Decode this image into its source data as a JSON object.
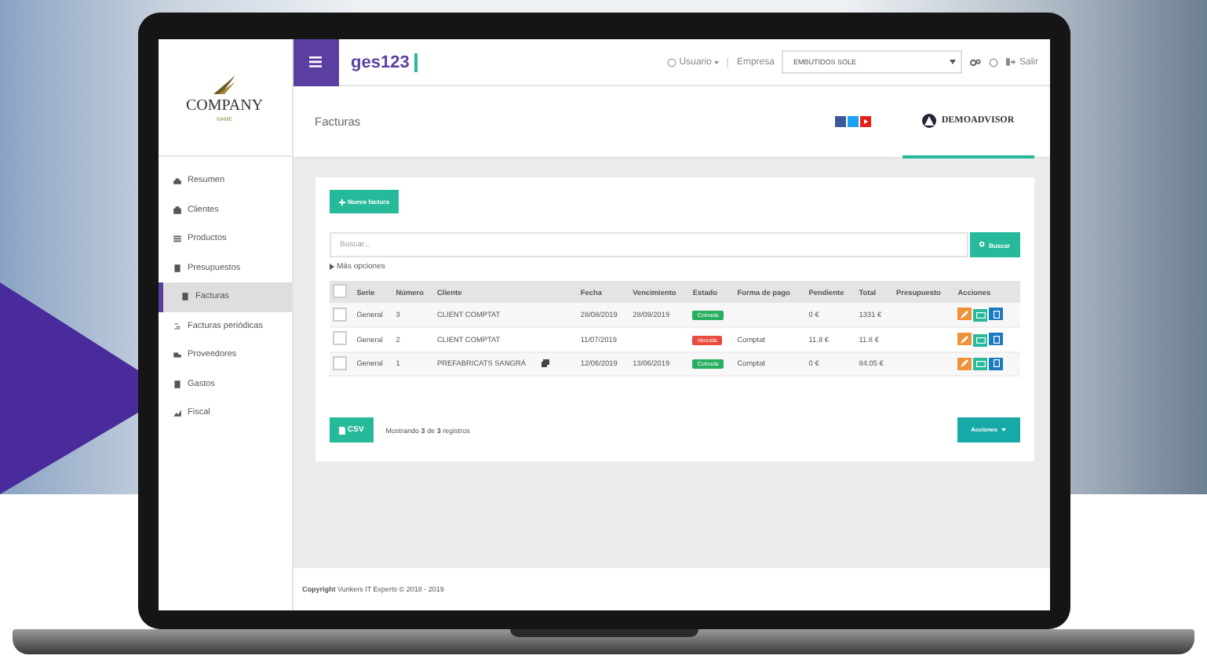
{
  "topbar": {
    "brand": "ges123",
    "user": "Usuario",
    "company_label": "Empresa",
    "company_value": "EMBUTIDOS SOLE",
    "logout": "Salir"
  },
  "logo": {
    "name": "COMPANY",
    "sub": "NAME"
  },
  "header": {
    "title": "Facturas",
    "partner": "DEMOADVISOR"
  },
  "sidebar": {
    "items": [
      {
        "label": "Resumen",
        "selected": false
      },
      {
        "label": "Clientes",
        "selected": false
      },
      {
        "label": "Productos",
        "selected": false
      },
      {
        "label": "Presupuestos",
        "selected": false
      },
      {
        "label": "Facturas",
        "selected": true
      },
      {
        "label": "Facturas periódicas",
        "selected": false
      },
      {
        "label": "Proveedores",
        "selected": false
      },
      {
        "label": "Gastos",
        "selected": false
      },
      {
        "label": "Fiscal",
        "selected": false
      }
    ]
  },
  "new_button": "Nueva factura",
  "search": {
    "placeholder": "Buscar...",
    "button": "Buscar"
  },
  "more_options": "Más opciones",
  "table": {
    "all_checked": false,
    "columns": [
      "Serie",
      "Número",
      "Cliente",
      "Fecha",
      "Vencimiento",
      "Estado",
      "Forma de pago",
      "Pendiente",
      "Total",
      "Presupuesto",
      "Acciones"
    ],
    "rows": [
      {
        "checked": false,
        "serie": "General",
        "numero": "3",
        "cliente": "CLIENT COMPTAT",
        "linked": false,
        "fecha": "28/08/2019",
        "vencimiento": "28/09/2019",
        "estado": "Cobrada",
        "color": "#27ae60",
        "pago": "",
        "pendiente": "0 €",
        "total": "1331 €"
      },
      {
        "checked": false,
        "serie": "General",
        "numero": "2",
        "cliente": "CLIENT COMPTAT",
        "linked": false,
        "fecha": "11/07/2019",
        "vencimiento": "",
        "estado": "Vencida",
        "color": "#e74c3c",
        "pago": "Comptat",
        "pendiente": "11.8 €",
        "total": "11.8 €"
      },
      {
        "checked": false,
        "serie": "General",
        "numero": "1",
        "cliente": "PREFABRICATS SANGRÀ",
        "linked": true,
        "fecha": "12/06/2019",
        "vencimiento": "13/06/2019",
        "estado": "Cobrada",
        "color": "#27ae60",
        "pago": "Comptat",
        "pendiente": "0 €",
        "total": "84.05 €"
      }
    ]
  },
  "csv_button": "CSV",
  "records": "Mostrando **3** de **3** registros",
  "actions_button": "Acciones",
  "footer": "**Copyright** Vunkers IT Experts © 2018 - 2019"
}
